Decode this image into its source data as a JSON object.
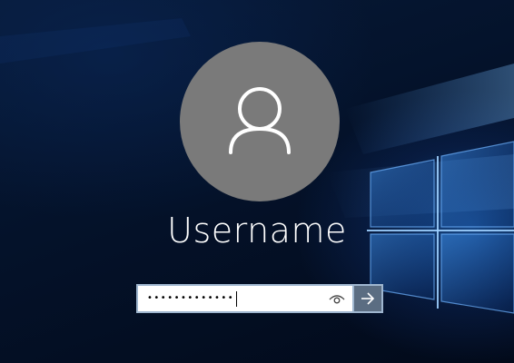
{
  "login": {
    "username": "Username",
    "password_mask": "•••••••••••••"
  },
  "icons": {
    "avatar": "user-silhouette-icon",
    "reveal": "eye-icon",
    "submit": "arrow-right-icon"
  },
  "colors": {
    "avatar_bg": "#7a7a7a",
    "submit_bg": "#5b6d82",
    "field_border": "#9fb6cf",
    "wallpaper_blue": "#2a7ad8"
  }
}
